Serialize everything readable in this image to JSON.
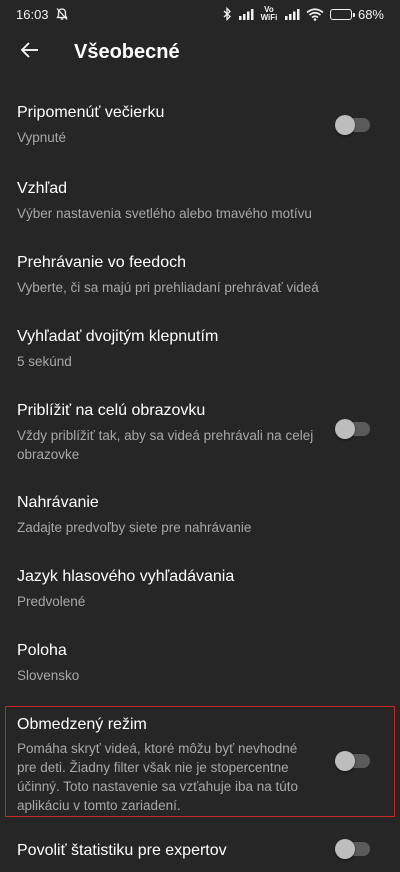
{
  "status_bar": {
    "time": "16:03",
    "volte": "Vo\nWiFi",
    "battery_percent": "68%",
    "battery_level": 0.68
  },
  "header": {
    "title": "Všeobecné"
  },
  "settings": [
    {
      "title": "Pripomenúť večierku",
      "subtitle": "Vypnuté",
      "toggle": true,
      "on": false
    },
    {
      "title": "Vzhľad",
      "subtitle": "Výber nastavenia svetlého alebo tmavého motívu",
      "toggle": false
    },
    {
      "title": "Prehrávanie vo feedoch",
      "subtitle": "Vyberte, či sa majú pri prehliadaní prehrávať videá",
      "toggle": false
    },
    {
      "title": "Vyhľadať dvojitým klepnutím",
      "subtitle": "5 sekúnd",
      "toggle": false
    },
    {
      "title": "Priblížiť na celú obrazovku",
      "subtitle": "Vždy priblížiť tak, aby sa videá prehrávali na celej obrazovke",
      "toggle": true,
      "on": false
    },
    {
      "title": "Nahrávanie",
      "subtitle": "Zadajte predvoľby siete pre nahrávanie",
      "toggle": false
    },
    {
      "title": "Jazyk hlasového vyhľadávania",
      "subtitle": "Predvolené",
      "toggle": false
    },
    {
      "title": "Poloha",
      "subtitle": "Slovensko",
      "toggle": false
    },
    {
      "title": "Obmedzený režim",
      "subtitle": "Pomáha skryť videá, ktoré môžu byť nevhodné pre deti. Žiadny filter však nie je stopercentne účinný. Toto nastavenie sa vzťahuje iba na túto aplikáciu v tomto zariadení.",
      "toggle": true,
      "on": false
    },
    {
      "title": "Povoliť štatistiku pre expertov",
      "subtitle": "",
      "toggle": true,
      "on": false
    }
  ],
  "colors": {
    "background": "#262626",
    "subtitle": "#a8a8a8",
    "highlight": "#c62828"
  }
}
